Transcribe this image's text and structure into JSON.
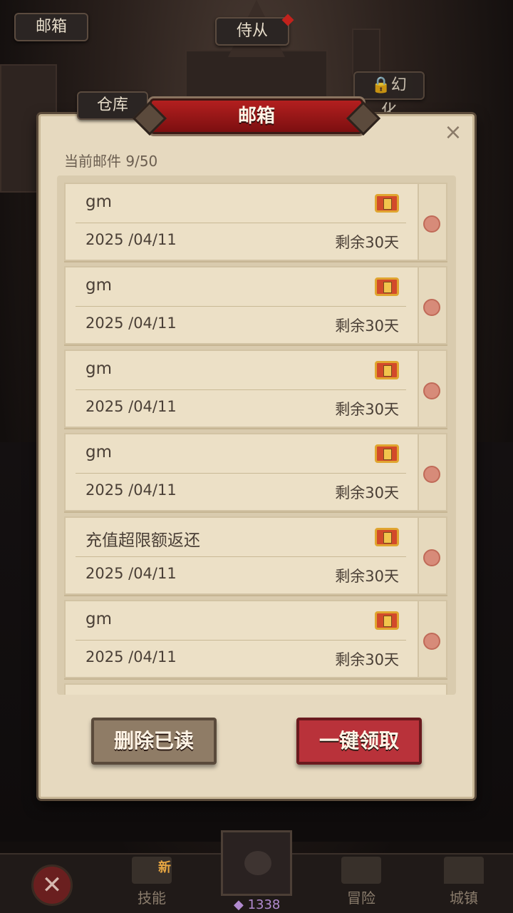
{
  "hud": {
    "mail_label": "邮箱",
    "servant_label": "侍从",
    "warehouse_label": "仓库",
    "illusion_label": "幻化"
  },
  "dialog": {
    "title": "邮箱",
    "close_icon": "×",
    "count_label": "当前邮件 9/50"
  },
  "mails": [
    {
      "sender": "gm",
      "date": "2025 /04/11",
      "remain": "剩余30天"
    },
    {
      "sender": "gm",
      "date": "2025 /04/11",
      "remain": "剩余30天"
    },
    {
      "sender": "gm",
      "date": "2025 /04/11",
      "remain": "剩余30天"
    },
    {
      "sender": "gm",
      "date": "2025 /04/11",
      "remain": "剩余30天"
    },
    {
      "sender": "充值超限额返还",
      "date": "2025 /04/11",
      "remain": "剩余30天"
    },
    {
      "sender": "gm",
      "date": "2025 /04/11",
      "remain": "剩余30天"
    }
  ],
  "buttons": {
    "delete_read": "删除已读",
    "claim_all": "一键领取"
  },
  "nav": {
    "close_icon": "✕",
    "skill": "技能",
    "skill_badge": "新",
    "gem_count": "1338",
    "adventure": "冒险",
    "town": "城镇"
  },
  "colors": {
    "accent_red": "#b9323a",
    "parchment": "#e6d9bf"
  }
}
